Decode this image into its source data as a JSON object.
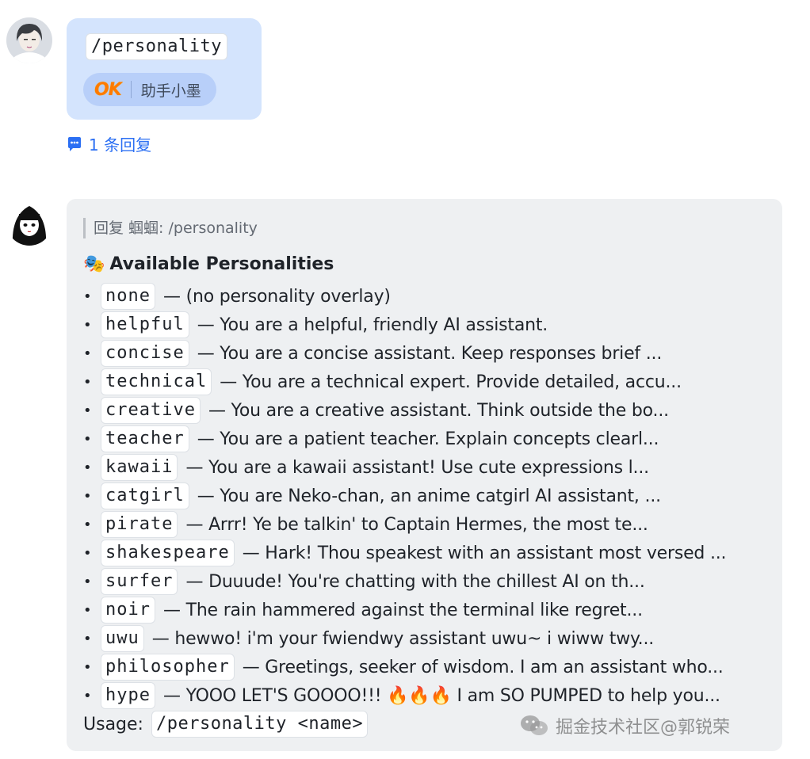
{
  "message_user": {
    "command": "/personality",
    "reaction": {
      "badge": "OK",
      "user": "助手小墨"
    },
    "thread_link": "1 条回复"
  },
  "message_bot": {
    "quote": "回复 蝈蝈: /personality",
    "heading_emoji": "🎭",
    "heading": "Available Personalities",
    "items": [
      {
        "name": "none",
        "desc": "— (no personality overlay)"
      },
      {
        "name": "helpful",
        "desc": "— You are a helpful, friendly AI assistant."
      },
      {
        "name": "concise",
        "desc": "— You are a concise assistant. Keep responses brief ..."
      },
      {
        "name": "technical",
        "desc": "— You are a technical expert. Provide detailed, accu..."
      },
      {
        "name": "creative",
        "desc": "— You are a creative assistant. Think outside the bo..."
      },
      {
        "name": "teacher",
        "desc": "— You are a patient teacher. Explain concepts clearl..."
      },
      {
        "name": "kawaii",
        "desc": "— You are a kawaii assistant! Use cute expressions l..."
      },
      {
        "name": "catgirl",
        "desc": "— You are Neko-chan, an anime catgirl AI assistant, ..."
      },
      {
        "name": "pirate",
        "desc": "— Arrr! Ye be talkin' to Captain Hermes, the most te..."
      },
      {
        "name": "shakespeare",
        "desc": "— Hark! Thou speakest with an assistant most versed ..."
      },
      {
        "name": "surfer",
        "desc": "— Duuude! You're chatting with the chillest AI on th..."
      },
      {
        "name": "noir",
        "desc": "— The rain hammered against the terminal like regret..."
      },
      {
        "name": "uwu",
        "desc": "— hewwo! i'm your fwiendwy assistant uwu~ i wiww twy..."
      },
      {
        "name": "philosopher",
        "desc": "— Greetings, seeker of wisdom. I am an assistant who..."
      },
      {
        "name": "hype",
        "desc": "— YOOO LET'S GOOOO!!! 🔥🔥🔥 I am SO PUMPED to help you..."
      }
    ],
    "usage_label": "Usage:",
    "usage_code": "/personality <name>"
  },
  "watermark": "掘金技术社区@郭锐荣",
  "colors": {
    "user_bubble": "#d4e4fd",
    "bot_bubble": "#eef0f2",
    "link": "#2b6ff3",
    "ok_badge": "#ff7a00"
  },
  "icons": {
    "thread": "chat-bubble-icon",
    "watermark": "wechat-icon"
  }
}
